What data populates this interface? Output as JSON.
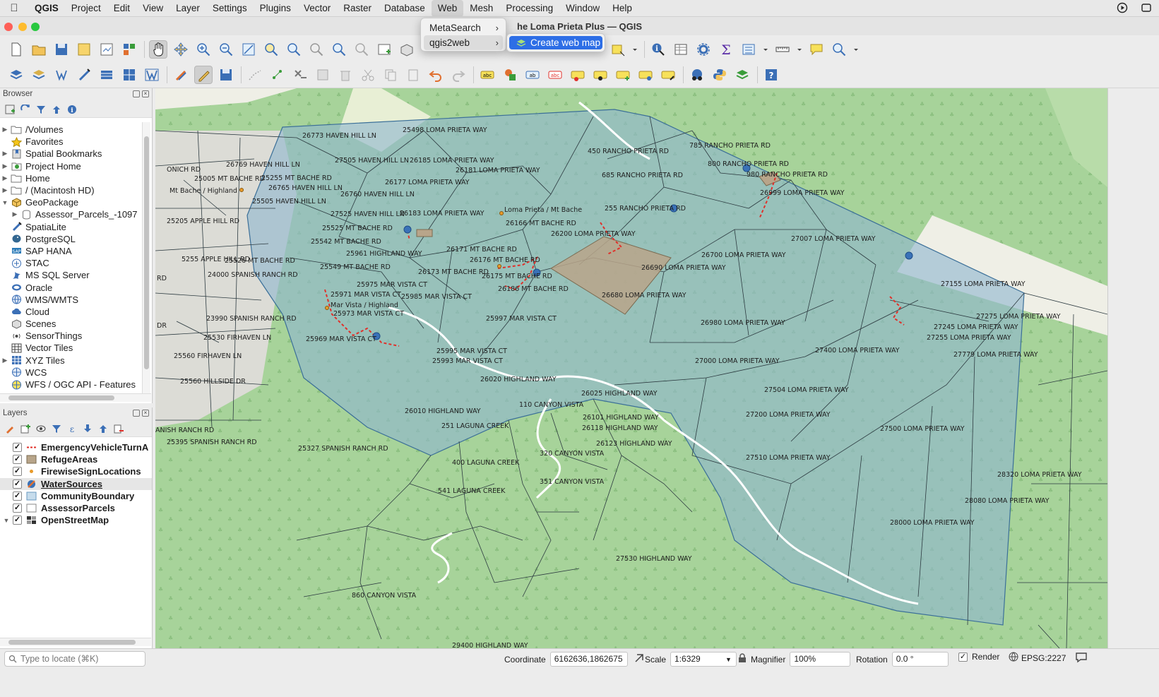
{
  "menubar": {
    "app_name": "QGIS",
    "items": [
      "Project",
      "Edit",
      "View",
      "Layer",
      "Settings",
      "Plugins",
      "Vector",
      "Raster",
      "Database",
      "Web",
      "Mesh",
      "Processing",
      "Window",
      "Help"
    ],
    "active_item": "Web"
  },
  "window": {
    "title": "he Loma Prieta Plus — QGIS"
  },
  "web_menu": {
    "items": [
      {
        "label": "MetaSearch"
      },
      {
        "label": "qgis2web"
      }
    ],
    "submenu": {
      "label": "Create web map"
    }
  },
  "browser": {
    "title": "Browser",
    "items": [
      {
        "label": "/Volumes",
        "icon": "folder-icon",
        "expand": "▶"
      },
      {
        "label": "Favorites",
        "icon": "star-icon",
        "expand": ""
      },
      {
        "label": "Spatial Bookmarks",
        "icon": "bookmark-icon",
        "expand": "▶"
      },
      {
        "label": "Project Home",
        "icon": "project-home-icon",
        "expand": "▶"
      },
      {
        "label": "Home",
        "icon": "folder-icon",
        "expand": "▶"
      },
      {
        "label": "/ (Macintosh HD)",
        "icon": "folder-icon",
        "expand": "▶"
      },
      {
        "label": "GeoPackage",
        "icon": "geopackage-icon",
        "expand": "▼"
      },
      {
        "label": "Assessor_Parcels_-1097",
        "icon": "table-icon",
        "expand": "▶",
        "indent": true
      },
      {
        "label": "SpatiaLite",
        "icon": "spatialite-icon",
        "expand": ""
      },
      {
        "label": "PostgreSQL",
        "icon": "postgresql-icon",
        "expand": ""
      },
      {
        "label": "SAP HANA",
        "icon": "saphana-icon",
        "expand": ""
      },
      {
        "label": "STAC",
        "icon": "stac-icon",
        "expand": ""
      },
      {
        "label": "MS SQL Server",
        "icon": "mssql-icon",
        "expand": ""
      },
      {
        "label": "Oracle",
        "icon": "oracle-icon",
        "expand": ""
      },
      {
        "label": "WMS/WMTS",
        "icon": "wms-icon",
        "expand": ""
      },
      {
        "label": "Cloud",
        "icon": "cloud-icon",
        "expand": ""
      },
      {
        "label": "Scenes",
        "icon": "scenes-icon",
        "expand": ""
      },
      {
        "label": "SensorThings",
        "icon": "sensorthings-icon",
        "expand": ""
      },
      {
        "label": "Vector Tiles",
        "icon": "vector-tiles-icon",
        "expand": ""
      },
      {
        "label": "XYZ Tiles",
        "icon": "xyz-tiles-icon",
        "expand": "▶"
      },
      {
        "label": "WCS",
        "icon": "wcs-icon",
        "expand": ""
      },
      {
        "label": "WFS / OGC API - Features",
        "icon": "wfs-icon",
        "expand": ""
      }
    ]
  },
  "layers": {
    "title": "Layers",
    "items": [
      {
        "label": "EmergencyVehicleTurnA",
        "symbol": "dashed-line",
        "checked": "✓"
      },
      {
        "label": "RefugeAreas",
        "symbol": "tan-fill",
        "checked": "✓"
      },
      {
        "label": "FirewiseSignLocations",
        "symbol": "orange-dot",
        "checked": "✓"
      },
      {
        "label": "WaterSources",
        "symbol": "multi-symbol",
        "checked": "✓",
        "selected": true
      },
      {
        "label": "CommunityBoundary",
        "symbol": "blue-fill",
        "checked": "✓"
      },
      {
        "label": "AssessorParcels",
        "symbol": "empty-fill",
        "checked": "✓"
      },
      {
        "label": "OpenStreetMap",
        "symbol": "raster-tile",
        "checked": "✓",
        "expand": "▼"
      }
    ]
  },
  "map_labels": [
    "26773 HAVEN HILL LN",
    "25498 LOMA PRIETA WAY",
    "26769 HAVEN HILL LN",
    "27505 HAVEN HILL LN",
    "26185 LOMA PRIETA WAY",
    "26181 LOMA PRIETA WAY",
    "25255 MT BACHE RD",
    "25005 MT BACHE RD",
    "26765 HAVEN HILL LN",
    "26177 LOMA PRIETA WAY",
    "26760 HAVEN HILL LN",
    "25505 HAVEN HILL LN",
    "27525 HAVEN HILL LN",
    "26183 LOMA PRIETA WAY",
    "25205 APPLE HILL RD",
    "25525 MT BACHE RD",
    "25542 MT BACHE RD",
    "25961 HIGHLAND WAY",
    "26171 MT BACHE RD",
    "26176 MT BACHE RD",
    "25526 MT BACHE RD",
    "25549 MT BACHE RD",
    "26173 MT BACHE RD",
    "26175 MT BACHE RD",
    "24000 SPANISH RANCH RD",
    "25975 MAR VISTA CT",
    "26186 MT BACHE RD",
    "25971 MAR VISTA CT",
    "25985 MAR VISTA CT",
    "25973 MAR VISTA CT",
    "23990 SPANISH RANCH RD",
    "25969 MAR VISTA CT",
    "25997 MAR VISTA CT",
    "25530 FIRHAVEN LN",
    "25995 MAR VISTA CT",
    "25993 MAR VISTA CT",
    "25560 FIRHAVEN LN",
    "26020 HIGHLAND WAY",
    "25560 HILLSIDE DR",
    "26010 HIGHLAND WAY",
    "251 LAGUNA CREEK",
    "110 CANYON VISTA",
    "25327 SPANISH RANCH RD",
    "25395 SPANISH RANCH RD",
    "400 LAGUNA CREEK",
    "320 CANYON VISTA",
    "351 CANYON VISTA",
    "541 LAGUNA CREEK",
    "860 CANYON VISTA",
    "29400 HIGHLAND WAY",
    "450 RANCHO PRIETA RD",
    "785 RANCHO PRIETA RD",
    "800 RANCHO PRIETA RD",
    "685 RANCHO PRIETA RD",
    "980 RANCHO PRIETA RD",
    "26999 LOMA PRIETA WAY",
    "255 RANCHO PRIETA RD",
    "26166 MT BACHE RD",
    "26200 LOMA PRIETA WAY",
    "27007 LOMA PRIETA WAY",
    "26700 LOMA PRIETA WAY",
    "26690 LOMA PRIETA WAY",
    "26680 LOMA PRIETA WAY",
    "27155 LOMA PRIETA WAY",
    "26980 LOMA PRIETA WAY",
    "27275 LOMA PRIETA WAY",
    "27245 LOMA PRIETA WAY",
    "27255 LOMA PRIETA WAY",
    "27400 LOMA PRIETA WAY",
    "27779 LOMA PRIETA WAY",
    "27000 LOMA PRIETA WAY",
    "27504 LOMA PRIETA WAY",
    "26025 HIGHLAND WAY",
    "27200 LOMA PRIETA WAY",
    "26101 HIGHLAND WAY",
    "26118 HIGHLAND WAY",
    "27500 LOMA PRIETA WAY",
    "26123 HIGHLAND WAY",
    "27510 LOMA PRIETA WAY",
    "28320 LOMA PRIETA WAY",
    "28080 LOMA PRIETA WAY",
    "28000 LOMA PRIETA WAY",
    "27530 HIGHLAND WAY",
    "Mt Bache / Highland",
    "Loma Prieta / Mt Bache",
    "Mar Vista / Highland",
    "ONICH RD",
    "ANISH RANCH RD",
    "DR",
    "5255 APPLE HILL RD",
    "RD"
  ],
  "status": {
    "locate_placeholder": "Type to locate (⌘K)",
    "coordinate_label": "Coordinate",
    "coordinate_value": "6162636,1862675",
    "scale_label": "Scale",
    "scale_value": "1:6329",
    "magnifier_label": "Magnifier",
    "magnifier_value": "100%",
    "rotation_label": "Rotation",
    "rotation_value": "0.0 °",
    "render_label": "Render",
    "crs": "EPSG:2227",
    "render_checked": "✓"
  },
  "colors": {
    "forest_green": "#a7d39a",
    "boundary_blue": "#8fb7cf",
    "refuge_tan": "#b8a58a",
    "water_point": "#3a72b8",
    "turnaround_red": "#e0302a",
    "menu_highlight": "#2d6ee6"
  }
}
